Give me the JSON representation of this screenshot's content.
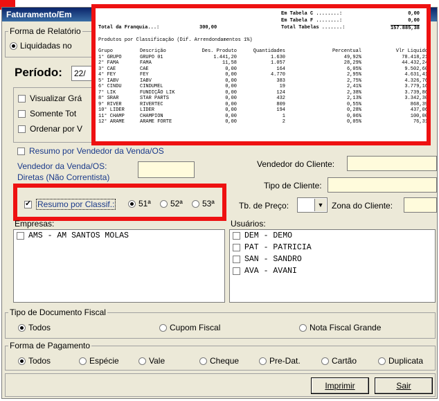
{
  "window": {
    "title": "Faturamento/Em"
  },
  "top_left": {
    "forma_relatorio_label": "Forma de Relatório",
    "liquidadas_label": "Liquidadas no",
    "periodo_label": "Período:",
    "periodo_value": "22/",
    "visualizar_label": "Visualizar Grá",
    "somente_label": "Somente Tot",
    "ordenar_label": "Ordenar por V",
    "resumo_vendedor_label": "Resumo por Vendedor da Venda/OS",
    "vendedor_venda_label": "Vendedor da Venda/OS:",
    "diretas_label": "Diretas (Não Correntista)"
  },
  "right_fields": {
    "vendedor_cliente_label": "Vendedor do Cliente:",
    "tipo_cliente_label": "Tipo de Cliente:",
    "tb_preco_label": "Tb. de Preço:",
    "zona_cliente_label": "Zona do Cliente:"
  },
  "resumo_classif": {
    "label": "Resumo por Classif.:",
    "options": [
      "51ª",
      "52ª",
      "53ª"
    ]
  },
  "empresas": {
    "label": "Empresas:",
    "items": [
      "AMS - AM SANTOS MOLAS"
    ]
  },
  "usuarios": {
    "label": "Usuários:",
    "items": [
      "DEM - DEMO",
      "PAT - PATRICIA",
      "SAN - SANDRO",
      "AVA - AVANI"
    ]
  },
  "tipo_documento": {
    "label": "Tipo de Documento Fiscal",
    "options": [
      "Todos",
      "Cupom Fiscal",
      "Nota Fiscal Grande"
    ]
  },
  "forma_pagamento": {
    "label": "Forma de Pagamento",
    "options": [
      "Todos",
      "Espécie",
      "Vale",
      "Cheque",
      "Pre-Dat.",
      "Cartão",
      "Duplicata"
    ]
  },
  "buttons": {
    "imprimir": "Imprimir",
    "sair": "Sair"
  },
  "report": {
    "em_tabela_c_label": "Em Tabela C ........:",
    "em_tabela_c_value": "0,00",
    "em_tabela_f_label": "Em Tabela F ........:",
    "em_tabela_f_value": "0,00",
    "total_franquia_label": "Total da Franquia...:",
    "total_franquia_value": "300,00",
    "total_tabelas_label": "Total Tabelas .......:",
    "total_tabelas_value": "157.885,38",
    "section_title": "Produtos por Classificação (Dif. Arrendondamentos 1%)",
    "headers": [
      "Grupo",
      "Descrição",
      "Des. Produto",
      "Quantidades",
      "Percentual",
      "Vlr Liquido"
    ],
    "rows": [
      [
        "1° GRUPO",
        "GRUPO 01",
        "1.441,20",
        "1.630",
        "49,92%",
        "78.418,21"
      ],
      [
        "2° FAMA",
        "FAMA",
        "11,58",
        "1.057",
        "28,29%",
        "44.432,24"
      ],
      [
        "3° CAE",
        "CAE",
        "0,00",
        "164",
        "6,05%",
        "9.502,60"
      ],
      [
        "4° FEY",
        "FEY",
        "0,00",
        "4.770",
        "2,95%",
        "4.631,41"
      ],
      [
        "5° IABV",
        "IABV",
        "0,00",
        "383",
        "2,75%",
        "4.326,76"
      ],
      [
        "6° CINDU",
        "CINDUMEL",
        "0,00",
        "19",
        "2,41%",
        "3.779,16"
      ],
      [
        "7° LIK",
        "FUNDIÇÃO LIK",
        "0,00",
        "124",
        "2,38%",
        "3.739,86"
      ],
      [
        "8° SRAR",
        "STAR PARTS",
        "0,00",
        "432",
        "2,13%",
        "3.342,30"
      ],
      [
        "9° RIVER",
        "RIVERTEC",
        "0,00",
        "809",
        "0,55%",
        "868,39"
      ],
      [
        "10° LIDER",
        "LIDER",
        "0,00",
        "194",
        "0,28%",
        "437,06"
      ],
      [
        "11° CHAMP",
        "CHAMPION",
        "0,00",
        "1",
        "0,06%",
        "100,00"
      ],
      [
        "12° ARAME",
        "ARAME FORTE",
        "0,00",
        "2",
        "0,05%",
        "76,31"
      ]
    ]
  }
}
